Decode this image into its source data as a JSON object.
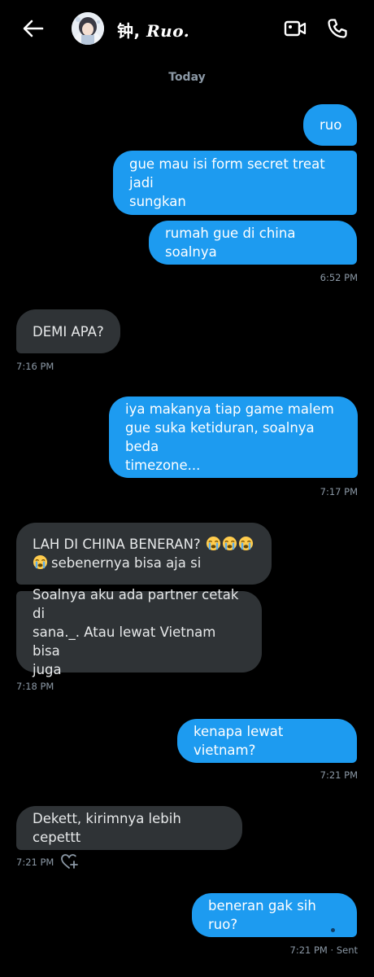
{
  "header": {
    "contact_name_prefix": "钟, ",
    "contact_name_styled": "Ruo.",
    "back_icon": "arrow-left-icon",
    "video_icon": "video-call-icon",
    "call_icon": "phone-icon"
  },
  "date_separator": "Today",
  "messages": [
    {
      "dir": "out",
      "text": "ruo"
    },
    {
      "dir": "out",
      "line1": "gue mau isi form secret treat jadi",
      "line2": "sungkan"
    },
    {
      "dir": "out",
      "text": "rumah gue di china soalnya"
    },
    {
      "dir": "in",
      "text": "DEMI APA?"
    },
    {
      "dir": "out",
      "line1": "iya makanya tiap game malem",
      "line2": "gue suka ketiduran, soalnya beda",
      "line3": "timezone..."
    },
    {
      "dir": "in",
      "line1": "LAH DI CHINA BENERAN?",
      "line2": "sebenernya bisa aja si"
    },
    {
      "dir": "in",
      "line1": "Soalnya aku ada partner cetak di",
      "line2": "sana._. Atau lewat Vietnam bisa",
      "line3": "juga"
    },
    {
      "dir": "out",
      "text": "kenapa lewat vietnam?"
    },
    {
      "dir": "in",
      "text": "Dekett, kirimnya lebih cepettt"
    },
    {
      "dir": "out",
      "text": "beneran gak sih ruo?"
    }
  ],
  "timestamps": {
    "t1": "6:52 PM",
    "t2": "7:16 PM",
    "t3": "7:17 PM",
    "t4": "7:18 PM",
    "t5": "7:21 PM",
    "t6": "7:21 PM",
    "t7": "7:21 PM · Sent"
  },
  "icons": {
    "emoji": "loudly-crying-face-icon",
    "reaction": "add-reaction-heart-icon"
  },
  "colors": {
    "outgoing_bubble": "#1d9bf0",
    "incoming_bubble": "#2f3336",
    "background": "#000000",
    "muted_text": "#8b98a5"
  }
}
